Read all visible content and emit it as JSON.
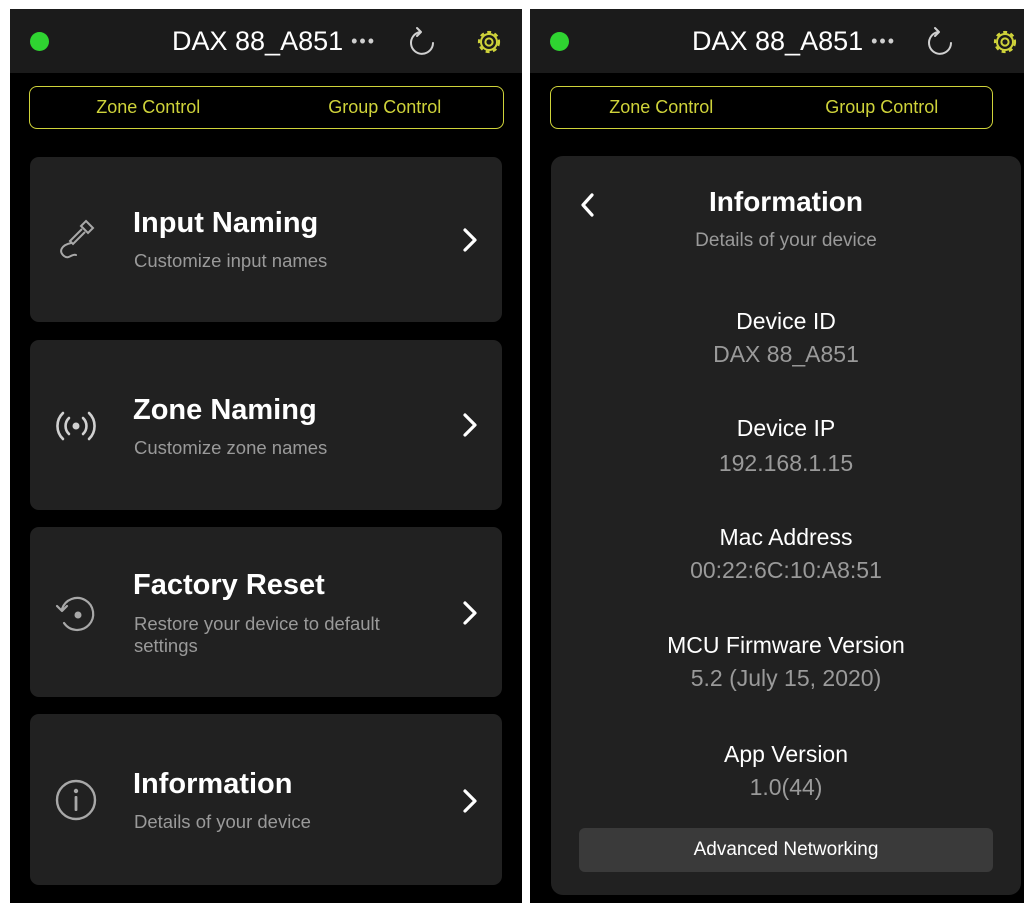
{
  "colors": {
    "accent": "#cfd33a",
    "status_green": "#2fd431",
    "background": "#000000",
    "card": "#212121",
    "header": "#1b1b1b"
  },
  "left_screen": {
    "header": {
      "device_name": "DAX 88_A851",
      "more_dots": "•••",
      "status": "status-dot-icon",
      "refresh": "refresh-icon",
      "settings": "gear-icon"
    },
    "segmented": {
      "zone_tab": "Zone Control",
      "group_tab": "Group Control"
    },
    "menu_items": [
      {
        "title": "Input Naming",
        "subtitle": "Customize input names",
        "icon": "audio-cable-icon"
      },
      {
        "title": "Zone Naming",
        "subtitle": "Customize zone names",
        "icon": "broadcast-icon"
      },
      {
        "title": "Factory Reset",
        "subtitle": "Restore your device to default settings",
        "icon": "reset-icon"
      },
      {
        "title": "Information",
        "subtitle": "Details of your device",
        "icon": "info-icon"
      }
    ]
  },
  "right_screen": {
    "header": {
      "device_name": "DAX 88_A851",
      "more_dots": "•••"
    },
    "segmented": {
      "zone_tab": "Zone Control",
      "group_tab": "Group Control"
    },
    "info_panel": {
      "title": "Information",
      "subtitle": "Details of your device",
      "fields": [
        {
          "label": "Device ID",
          "value": "DAX 88_A851"
        },
        {
          "label": "Device IP",
          "value": "192.168.1.15"
        },
        {
          "label": "Mac Address",
          "value": "00:22:6C:10:A8:51"
        },
        {
          "label": "MCU Firmware Version",
          "value": "5.2 (July 15, 2020)"
        },
        {
          "label": "App Version",
          "value": "1.0(44)"
        }
      ],
      "button_label": "Advanced Networking"
    }
  }
}
